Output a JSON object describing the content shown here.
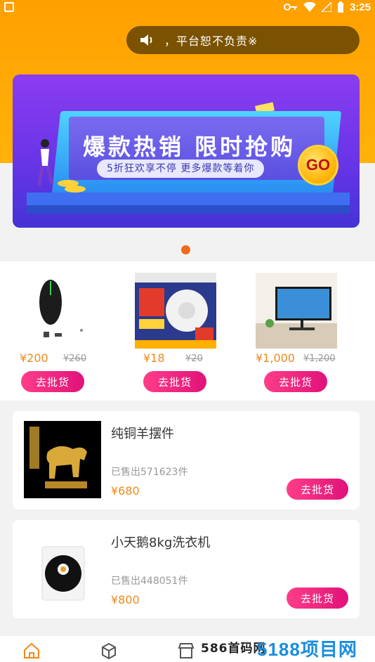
{
  "status_bar": {
    "time": "3:25"
  },
  "notice": {
    "text": "，平台恕不负责",
    "mark": "※"
  },
  "banner": {
    "title": "爆款热销 限时抢购",
    "subtitle": "5折狂欢享不停 更多爆款等着你",
    "go": "GO"
  },
  "products": [
    {
      "price": "¥200",
      "old_price": "¥260",
      "button": "去批货",
      "image": "gaming-mouse"
    },
    {
      "price": "¥18",
      "old_price": "¥20",
      "button": "去批货",
      "image": "smoke-detector"
    },
    {
      "price": "¥1,000",
      "old_price": "¥1,200",
      "button": "去批货",
      "image": "monitor"
    }
  ],
  "cards": [
    {
      "name": "纯铜羊摆件",
      "sold": "已售出571623件",
      "price": "¥680",
      "button": "去批货",
      "image": "golden-goat"
    },
    {
      "name": "小天鹅8kg洗衣机",
      "sold": "已售出448051件",
      "price": "¥800",
      "button": "去批货",
      "image": "washer-panel"
    }
  ],
  "tabbar": {
    "icons": [
      "home-icon",
      "box-icon",
      "store-icon"
    ]
  },
  "watermark": {
    "text": "586首码网",
    "logo": "5188项目网"
  },
  "colors": {
    "accent": "#ffa000",
    "button": "#e0127a",
    "price": "#f08a1a"
  }
}
